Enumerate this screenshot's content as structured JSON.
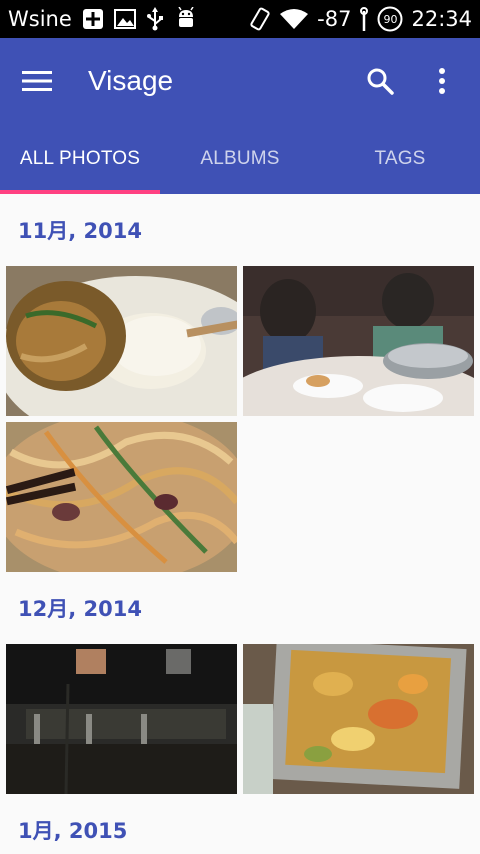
{
  "status_bar": {
    "carrier": "Wsine",
    "signal": "-87",
    "battery": "90",
    "time": "22:34"
  },
  "app": {
    "title": "Visage"
  },
  "tabs": [
    {
      "label": "ALL PHOTOS",
      "active": true
    },
    {
      "label": "ALBUMS",
      "active": false
    },
    {
      "label": "TAGS",
      "active": false
    }
  ],
  "sections": [
    {
      "date": "11月, 2014",
      "photos": [
        "food-plate-rice",
        "people-dining-hotpot",
        "fried-noodles"
      ]
    },
    {
      "date": "12月, 2014",
      "photos": [
        "night-building",
        "food-tray"
      ]
    },
    {
      "date": "1月, 2015",
      "photos": []
    }
  ],
  "colors": {
    "primary": "#3f51b5",
    "accent": "#ff4081",
    "background": "#fafafa"
  }
}
